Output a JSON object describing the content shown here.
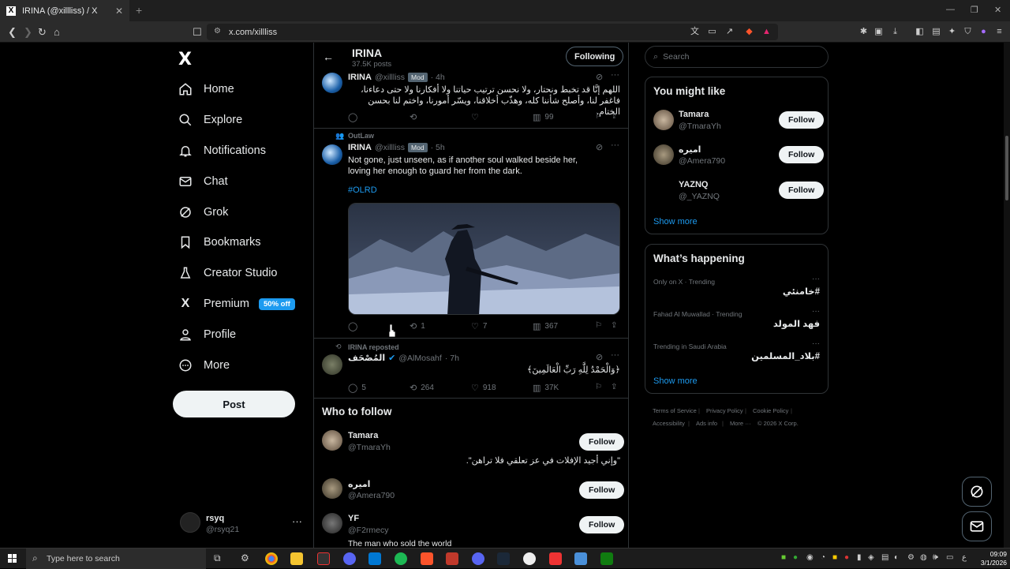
{
  "browser": {
    "tab_title": "IRINA (@xillliss) / X",
    "tab_favicon": "X",
    "url": "x.com/xillliss",
    "new_tab": "+"
  },
  "nav": {
    "logo": "X",
    "items": [
      {
        "label": "Home",
        "icon": "home-icon"
      },
      {
        "label": "Explore",
        "icon": "search-icon"
      },
      {
        "label": "Notifications",
        "icon": "bell-icon"
      },
      {
        "label": "Chat",
        "icon": "mail-icon"
      },
      {
        "label": "Grok",
        "icon": "grok-icon"
      },
      {
        "label": "Bookmarks",
        "icon": "bookmark-icon"
      },
      {
        "label": "Creator Studio",
        "icon": "flask-icon"
      },
      {
        "label": "Premium",
        "icon": "x-icon"
      },
      {
        "label": "Profile",
        "icon": "person-icon"
      },
      {
        "label": "More",
        "icon": "more-circle-icon"
      }
    ],
    "premium_badge": "50% off",
    "post_button": "Post",
    "account": {
      "name": "rsyq",
      "handle": "@rsyq21",
      "more": "···"
    }
  },
  "profile_header": {
    "name": "IRINA",
    "posts": "37.5K posts",
    "following_button": "Following"
  },
  "tweets": [
    {
      "name": "IRINA",
      "handle": "@xillliss",
      "badge": "Mod",
      "time": "· 4h",
      "text": "اللهم إنَّا قد تخبط ونحتار، ولا نحسن ترتيب حياتنا ولا أفكارنا ولا حتى دعاءنا، فاغفر لنا، وأصلح شأننا كله، وهذّب أخلاقنا، ويسّر أمورنا، واختم لنا بحسن الختام.",
      "replies": "",
      "reposts": "",
      "likes": "",
      "views": "99"
    },
    {
      "community": "OutLaw",
      "name": "IRINA",
      "handle": "@xillliss",
      "badge": "Mod",
      "time": "· 5h",
      "text": "Not gone, just unseen, as if another soul walked beside her, loving her enough to guard her from the dark.",
      "hashtag": "#OLRD",
      "replies": "",
      "reposts": "1",
      "likes": "7",
      "views": "367"
    },
    {
      "reposted_by": "IRINA reposted",
      "name": "المُصْحَف",
      "handle": "@AlMosahf",
      "time": "· 7h",
      "text": "﴿وَالْحَمْدُ لِلَّهِ رَبِّ الْعَالَمِينَ﴾",
      "replies": "5",
      "reposts": "264",
      "likes": "918",
      "views": "37K"
    }
  ],
  "who_to_follow": {
    "title": "Who to follow",
    "follow_label": "Follow",
    "users": [
      {
        "name": "Tamara",
        "handle": "@TmaraYh",
        "bio": "\"وإني أجيد الإفلات في عز تعلقي فلا تراهن\"."
      },
      {
        "name": "اميره",
        "handle": "@Amera790",
        "bio": ""
      },
      {
        "name": "YF",
        "handle": "@F2rmecy",
        "bio": "The man who sold the world"
      }
    ]
  },
  "search": {
    "placeholder": "Search"
  },
  "you_might_like": {
    "title": "You might like",
    "follow_label": "Follow",
    "users": [
      {
        "name": "Tamara",
        "handle": "@TmaraYh"
      },
      {
        "name": "اميره",
        "handle": "@Amera790"
      },
      {
        "name": "YAZNQ",
        "handle": "@_YAZNQ"
      }
    ],
    "show_more": "Show more"
  },
  "happening": {
    "title": "What’s happening",
    "trends": [
      {
        "meta": "Only on X · Trending",
        "name": "#خامنئي"
      },
      {
        "meta": "Fahad Al Muwallad · Trending",
        "name": "فهد المولد"
      },
      {
        "meta": "Trending in Saudi Arabia",
        "name": "#بلاد_المسلمين"
      }
    ],
    "show_more": "Show more"
  },
  "footer": {
    "links": [
      "Terms of Service",
      "Privacy Policy",
      "Cookie Policy",
      "Accessibility",
      "Ads info",
      "More ···",
      "© 2026 X Corp."
    ]
  },
  "taskbar": {
    "search_placeholder": "Type here to search",
    "time": "09:09",
    "date": "3/1/2026",
    "lang": "ع"
  }
}
